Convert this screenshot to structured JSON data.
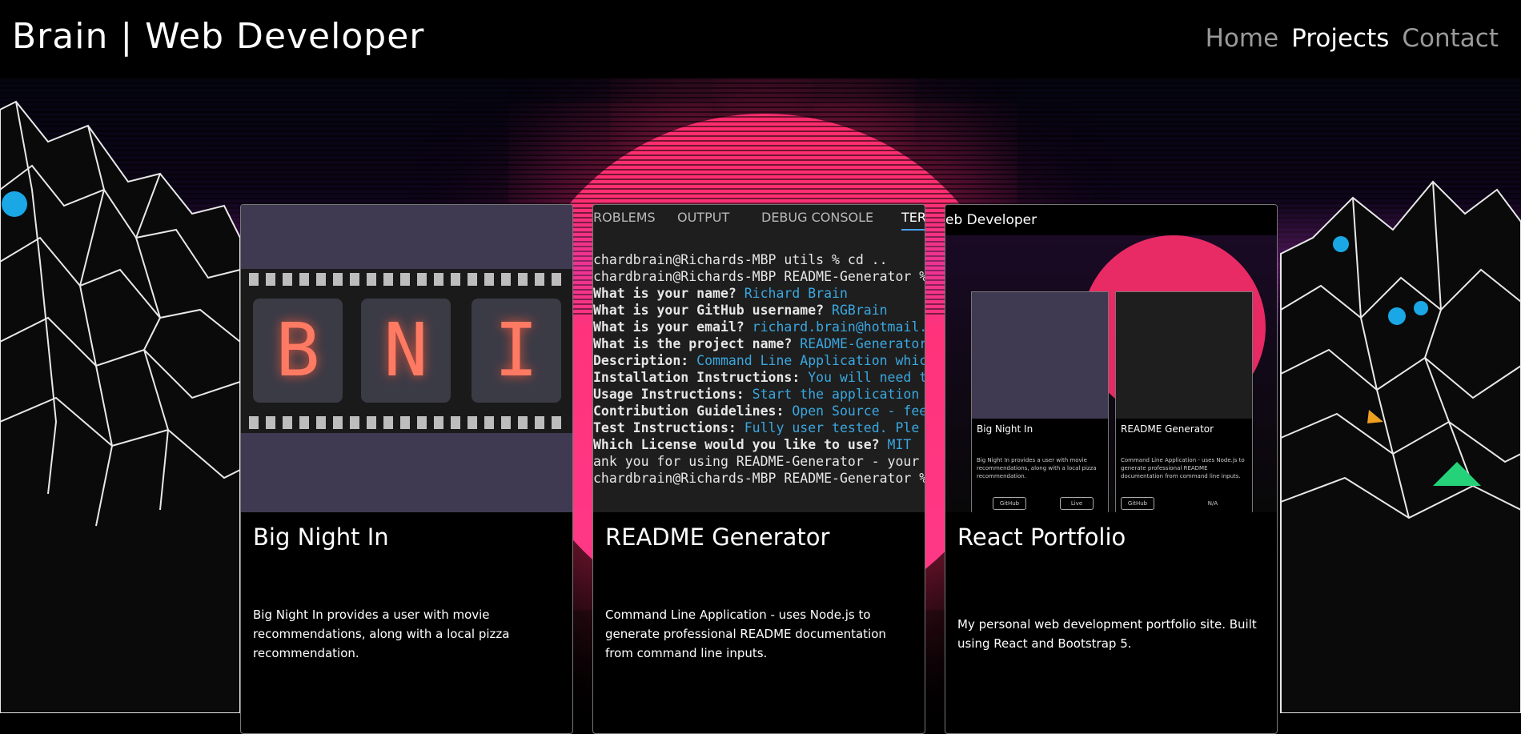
{
  "navbar": {
    "brand": "Brain | Web Developer",
    "links": [
      {
        "label": "Home",
        "active": false
      },
      {
        "label": "Projects",
        "active": true
      },
      {
        "label": "Contact",
        "active": false
      }
    ]
  },
  "colors": {
    "sun": "#ff2d6d",
    "terminal_value": "#3aa7e0",
    "nav_inactive": "#9a9a9a",
    "card_border": "#777777"
  },
  "projects": [
    {
      "title": "Big Night In",
      "description": "Big Night In provides a user with movie recommendations, along with a local pizza recommendation.",
      "image_letters": [
        "B",
        "N",
        "I"
      ]
    },
    {
      "title": "README Generator",
      "description": "Command Line Application - uses Node.js to generate professional README documentation from command line inputs.",
      "terminal_tabs": [
        "ROBLEMS",
        "OUTPUT",
        "DEBUG CONSOLE",
        "TER"
      ],
      "terminal_lines": [
        {
          "label": "chardbrain@Richards-MBP utils % cd ..",
          "value": ""
        },
        {
          "label": "chardbrain@Richards-MBP README-Generator %",
          "value": ""
        },
        {
          "label": "What is your name?",
          "value": "Richard Brain"
        },
        {
          "label": "What is your GitHub username?",
          "value": "RGBrain"
        },
        {
          "label": "What is your email?",
          "value": "richard.brain@hotmail."
        },
        {
          "label": "What is the project name?",
          "value": "README-Generator"
        },
        {
          "label": "Description:",
          "value": "Command Line Application whic"
        },
        {
          "label": "Installation Instructions:",
          "value": "You will need t"
        },
        {
          "label": "Usage Instructions:",
          "value": "Start the application"
        },
        {
          "label": "Contribution Guidelines:",
          "value": "Open Source - fee"
        },
        {
          "label": "Test Instructions:",
          "value": "Fully user tested.  Ple"
        },
        {
          "label": "Which License would you like to use?",
          "value": "MIT"
        },
        {
          "label": "ank you for using README-Generator - your",
          "value": ""
        },
        {
          "label": "chardbrain@Richards-MBP README-Generator %",
          "value": ""
        }
      ]
    },
    {
      "title": "React Portfolio",
      "description": "My personal web development portfolio site. Built using React and Bootstrap 5.",
      "preview_header": "eb Developer",
      "preview_cards": [
        {
          "title": "Big Night In",
          "text": "Big Night In provides a user with movie recommendations, along with a local pizza recommendation.",
          "buttons": [
            "GitHub",
            "Live"
          ]
        },
        {
          "title": "README Generator",
          "text": "Command Line Application - uses Node.js to generate professional README documentation from command line inputs.",
          "buttons": [
            "GitHub",
            "N/A"
          ]
        }
      ]
    }
  ]
}
